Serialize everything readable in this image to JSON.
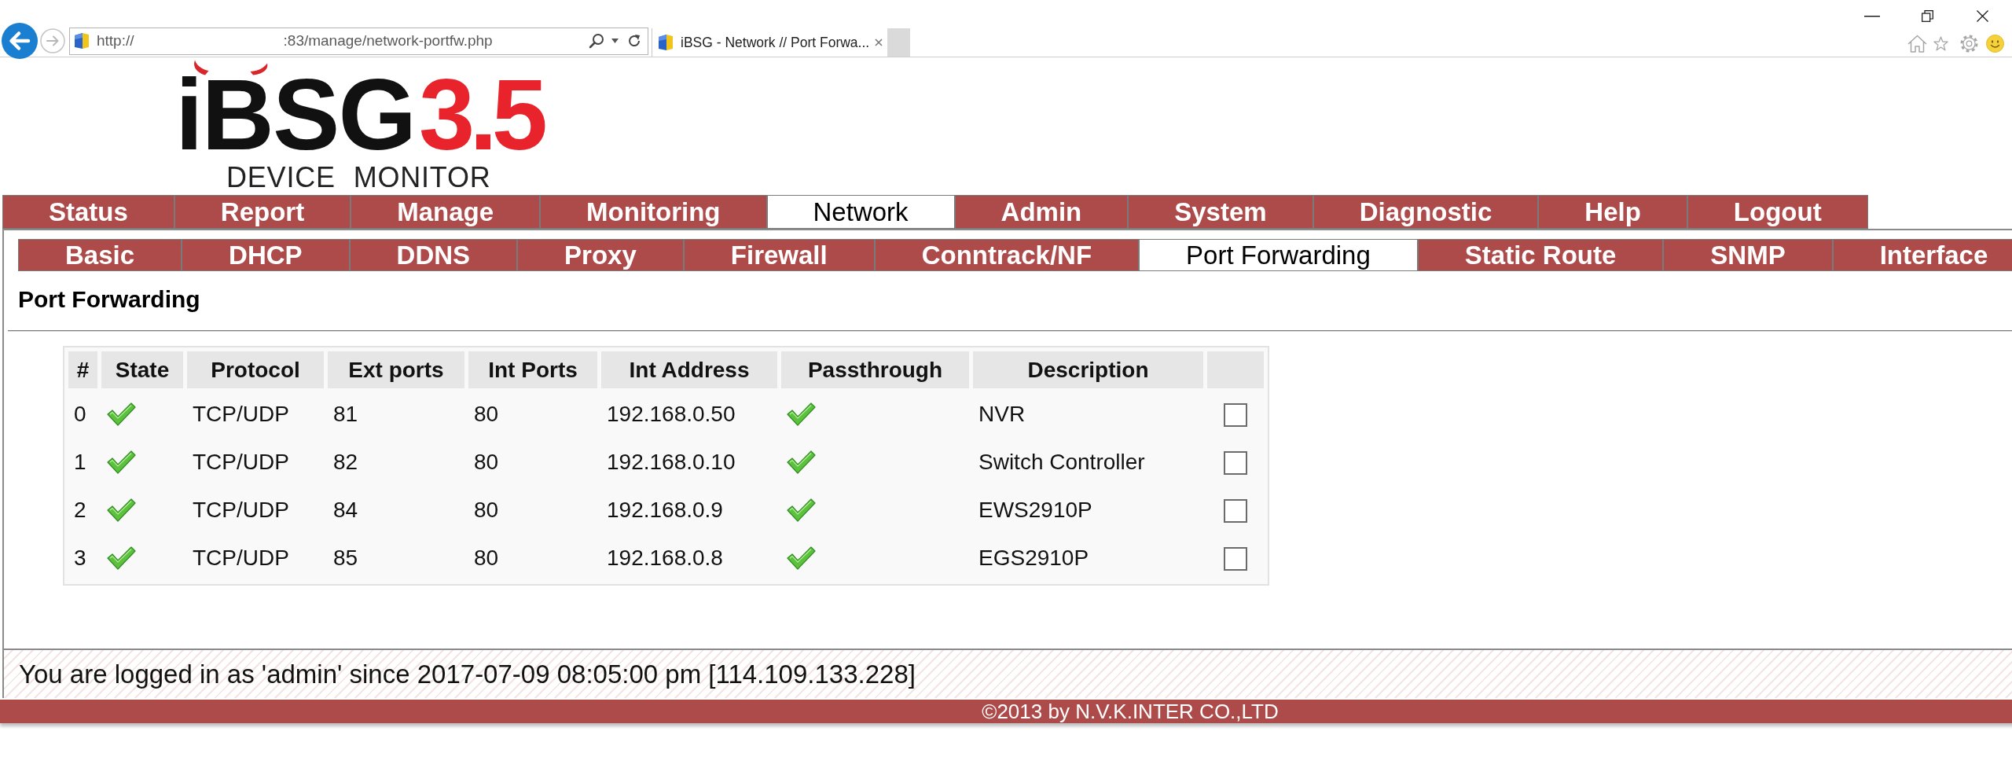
{
  "browser": {
    "url_scheme": "http://",
    "url_path": ":83/manage/network-portfw.php",
    "tab_title": "iBSG - Network // Port Forwa..."
  },
  "logo": {
    "name": "iBSG",
    "version": "3.5",
    "subtitle": "DEVICE MONITOR"
  },
  "main_tabs": [
    {
      "label": "Status",
      "selected": false
    },
    {
      "label": "Report",
      "selected": false
    },
    {
      "label": "Manage",
      "selected": false
    },
    {
      "label": "Monitoring",
      "selected": false
    },
    {
      "label": "Network",
      "selected": true
    },
    {
      "label": "Admin",
      "selected": false
    },
    {
      "label": "System",
      "selected": false
    },
    {
      "label": "Diagnostic",
      "selected": false
    },
    {
      "label": "Help",
      "selected": false
    },
    {
      "label": "Logout",
      "selected": false
    }
  ],
  "sub_tabs": [
    {
      "label": "Basic",
      "selected": false
    },
    {
      "label": "DHCP",
      "selected": false
    },
    {
      "label": "DDNS",
      "selected": false
    },
    {
      "label": "Proxy",
      "selected": false
    },
    {
      "label": "Firewall",
      "selected": false
    },
    {
      "label": "Conntrack/NF",
      "selected": false
    },
    {
      "label": "Port Forwarding",
      "selected": true
    },
    {
      "label": "Static Route",
      "selected": false
    },
    {
      "label": "SNMP",
      "selected": false
    },
    {
      "label": "Interface",
      "selected": false
    }
  ],
  "page_title": "Port Forwarding",
  "table": {
    "columns": [
      "#",
      "State",
      "Protocol",
      "Ext ports",
      "Int Ports",
      "Int Address",
      "Passthrough",
      "Description"
    ],
    "rows": [
      {
        "index": "0",
        "enabled": true,
        "protocol": "TCP/UDP",
        "ext_ports": "81",
        "int_ports": "80",
        "int_address": "192.168.0.50",
        "passthrough": true,
        "description": "NVR",
        "checked": false
      },
      {
        "index": "1",
        "enabled": true,
        "protocol": "TCP/UDP",
        "ext_ports": "82",
        "int_ports": "80",
        "int_address": "192.168.0.10",
        "passthrough": true,
        "description": "Switch Controller",
        "checked": false
      },
      {
        "index": "2",
        "enabled": true,
        "protocol": "TCP/UDP",
        "ext_ports": "84",
        "int_ports": "80",
        "int_address": "192.168.0.9",
        "passthrough": true,
        "description": "EWS2910P",
        "checked": false
      },
      {
        "index": "3",
        "enabled": true,
        "protocol": "TCP/UDP",
        "ext_ports": "85",
        "int_ports": "80",
        "int_address": "192.168.0.8",
        "passthrough": true,
        "description": "EGS2910P",
        "checked": false
      }
    ]
  },
  "status_line": "You are logged in as 'admin' since 2017-07-09 08:05:00 pm [114.109.133.228]",
  "footer": "©2013 by N.V.K.INTER CO.,LTD"
}
